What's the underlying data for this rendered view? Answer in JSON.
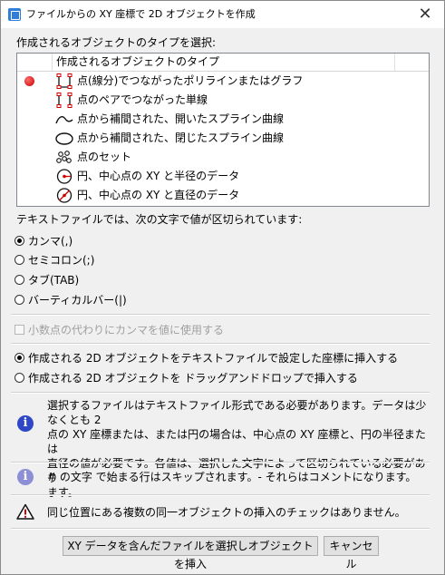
{
  "window": {
    "title": "ファイルからの XY 座標で 2D オブジェクトを作成",
    "close_glyph": "✕"
  },
  "object_type": {
    "section_label": "作成されるオブジェクトのタイプを選択:",
    "column_header": "作成されるオブジェクトのタイプ",
    "items": [
      {
        "label": "点(線分)でつながったポリラインまたはグラフ",
        "icon": "polyline-icon",
        "selected": true
      },
      {
        "label": "点のペアでつながった単線",
        "icon": "single-line-icon",
        "selected": false
      },
      {
        "label": "点から補間された、開いたスプライン曲線",
        "icon": "open-spline-icon",
        "selected": false
      },
      {
        "label": "点から補間された、閉じたスプライン曲線",
        "icon": "closed-spline-icon",
        "selected": false
      },
      {
        "label": "点のセット",
        "icon": "point-set-icon",
        "selected": false
      },
      {
        "label": "円、中心点の XY と半径のデータ",
        "icon": "circle-radius-icon",
        "selected": false
      },
      {
        "label": "円、中心点の XY と直径のデータ",
        "icon": "circle-diameter-icon",
        "selected": false
      }
    ],
    "selection_color": "#d00000"
  },
  "separator": {
    "section_label": "テキストファイルでは、次の文字で値が区切られています:",
    "options": [
      {
        "label": "カンマ(,)",
        "checked": true
      },
      {
        "label": "セミコロン(;)",
        "checked": false
      },
      {
        "label": "タブ(TAB)",
        "checked": false
      },
      {
        "label": "バーティカルバー(|)",
        "checked": false
      }
    ]
  },
  "decimal_comma": {
    "label": "小数点の代わりにカンマを値に使用する",
    "checked": false,
    "enabled": false
  },
  "insert_mode": {
    "options": [
      {
        "label": "作成される 2D オブジェクトをテキストファイルで設定した座標に挿入する",
        "checked": true
      },
      {
        "label": "作成される 2D オブジェクトを ドラッグアンドドロップで挿入する",
        "checked": false
      }
    ]
  },
  "notes": [
    {
      "icon": "info-icon",
      "lines": [
        "選択するファイルはテキストファイル形式である必要があります。データは少なくとも 2",
        "点の XY 座標または、または円の場合は、中心点の XY 座標と、円の半径または",
        "直径の値が必要です。各値は、選択した文字によって区切られている必要があり",
        "ます。"
      ]
    },
    {
      "icon": "info-icon",
      "text": "# の文字 で始まる行はスキップされます。- それらはコメントになります。"
    },
    {
      "icon": "warning-icon",
      "text": "同じ位置にある複数の同一オブジェクトの挿入のチェックはありません。"
    }
  ],
  "buttons": {
    "insert_label": "XY データを含んだファイルを選択しオブジェクトを挿入",
    "cancel_label": "キャンセル"
  },
  "colors": {
    "info_blue": "#2e47c6",
    "info_light": "#8d8fd6",
    "warning_red": "#d00000"
  }
}
